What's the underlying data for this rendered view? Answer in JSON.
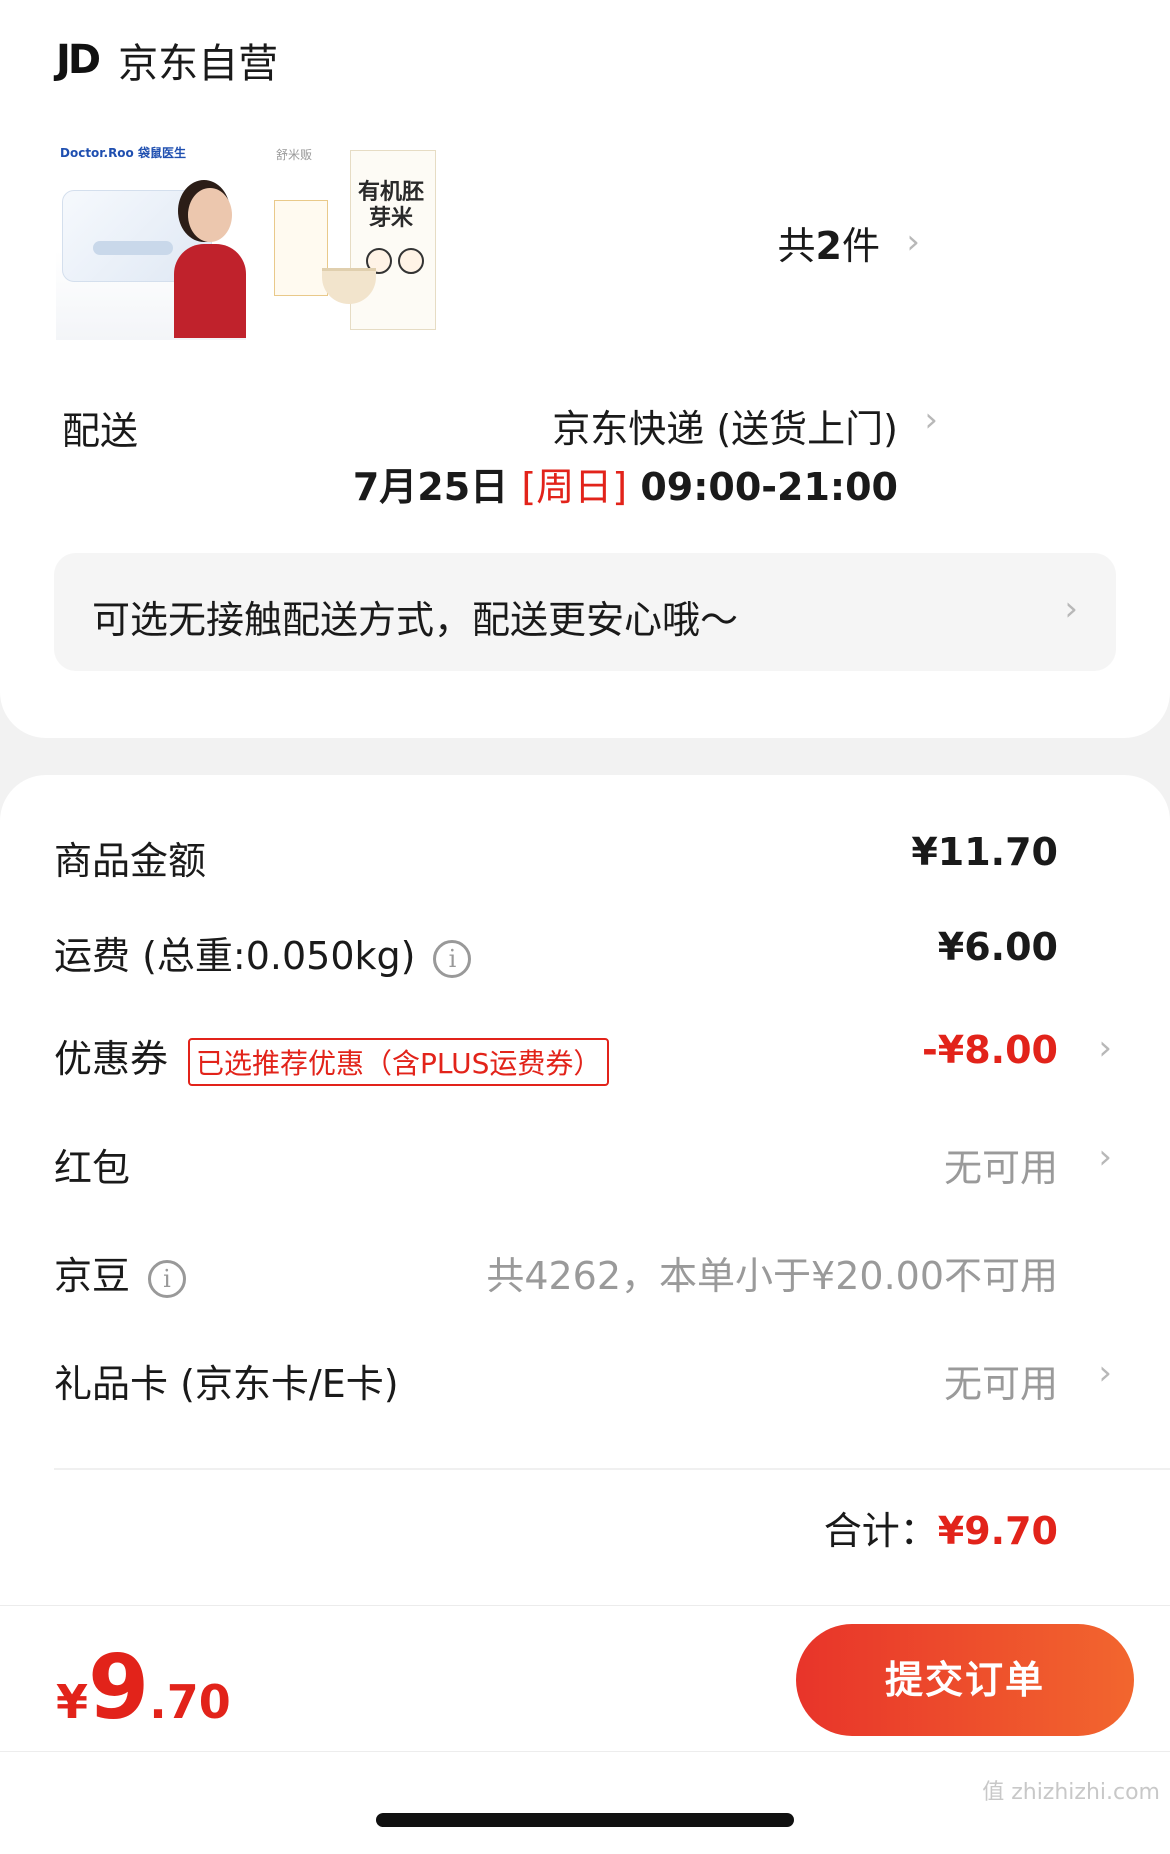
{
  "store": {
    "logo": "JD",
    "name": "京东自营"
  },
  "products": {
    "count_prefix": "共",
    "count": "2",
    "count_suffix": "件",
    "item1_brand": "Doctor.Roo 袋鼠医生",
    "item2_brand": "舒米贩",
    "item2_title": "有机胚芽米"
  },
  "delivery": {
    "label": "配送",
    "method": "京东快递 (送货上门)",
    "date": "7月25日",
    "weekday": "[周日]",
    "time": "09:00-21:00"
  },
  "notice": {
    "text": "可选无接触配送方式，配送更安心哦～"
  },
  "fees": {
    "goods_label": "商品金额",
    "goods_value": "¥11.70",
    "shipping_label": "运费 (总重:0.050kg)",
    "shipping_value": "¥6.00",
    "coupon_label": "优惠券",
    "coupon_tag": "已选推荐优惠（含PLUS运费券）",
    "coupon_value": "-¥8.00",
    "redpacket_label": "红包",
    "redpacket_value": "无可用",
    "jingdou_label": "京豆",
    "jingdou_value": "共4262，本单小于¥20.00不可用",
    "giftcard_label": "礼品卡 (京东卡/E卡)",
    "giftcard_value": "无可用",
    "total_label": "合计：",
    "total_value": "¥9.70"
  },
  "payment": {
    "currency": "¥",
    "price_int": "9",
    "price_dec": ".70",
    "submit_label": "提交订单"
  },
  "watermark": "值 zhizhizhi.com",
  "colors": {
    "accent": "#e2231a",
    "button_start": "#e8342a",
    "button_end": "#f2662e"
  }
}
